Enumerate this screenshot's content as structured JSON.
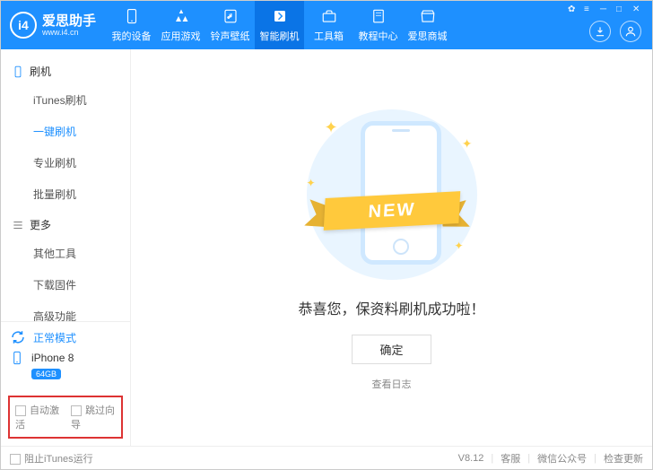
{
  "brand": {
    "name": "爱思助手",
    "url": "www.i4.cn",
    "logo": "i4"
  },
  "nav": [
    {
      "label": "我的设备",
      "icon": "phone"
    },
    {
      "label": "应用游戏",
      "icon": "apps"
    },
    {
      "label": "铃声壁纸",
      "icon": "music"
    },
    {
      "label": "智能刷机",
      "icon": "flash",
      "active": true
    },
    {
      "label": "工具箱",
      "icon": "tools"
    },
    {
      "label": "教程中心",
      "icon": "book"
    },
    {
      "label": "爱思商城",
      "icon": "shop"
    }
  ],
  "sidebar": {
    "group1": {
      "title": "刷机",
      "items": [
        "iTunes刷机",
        "一键刷机",
        "专业刷机",
        "批量刷机"
      ],
      "activeIndex": 1
    },
    "group2": {
      "title": "更多",
      "items": [
        "其他工具",
        "下载固件",
        "高级功能"
      ]
    },
    "mode": "正常模式",
    "device": {
      "name": "iPhone 8",
      "storage": "64GB"
    },
    "checks": [
      "自动激活",
      "跳过向导"
    ]
  },
  "main": {
    "ribbon": "NEW",
    "message": "恭喜您，保资料刷机成功啦！",
    "ok": "确定",
    "log": "查看日志"
  },
  "footer": {
    "block": "阻止iTunes运行",
    "version": "V8.12",
    "links": [
      "客服",
      "微信公众号",
      "检查更新"
    ]
  }
}
